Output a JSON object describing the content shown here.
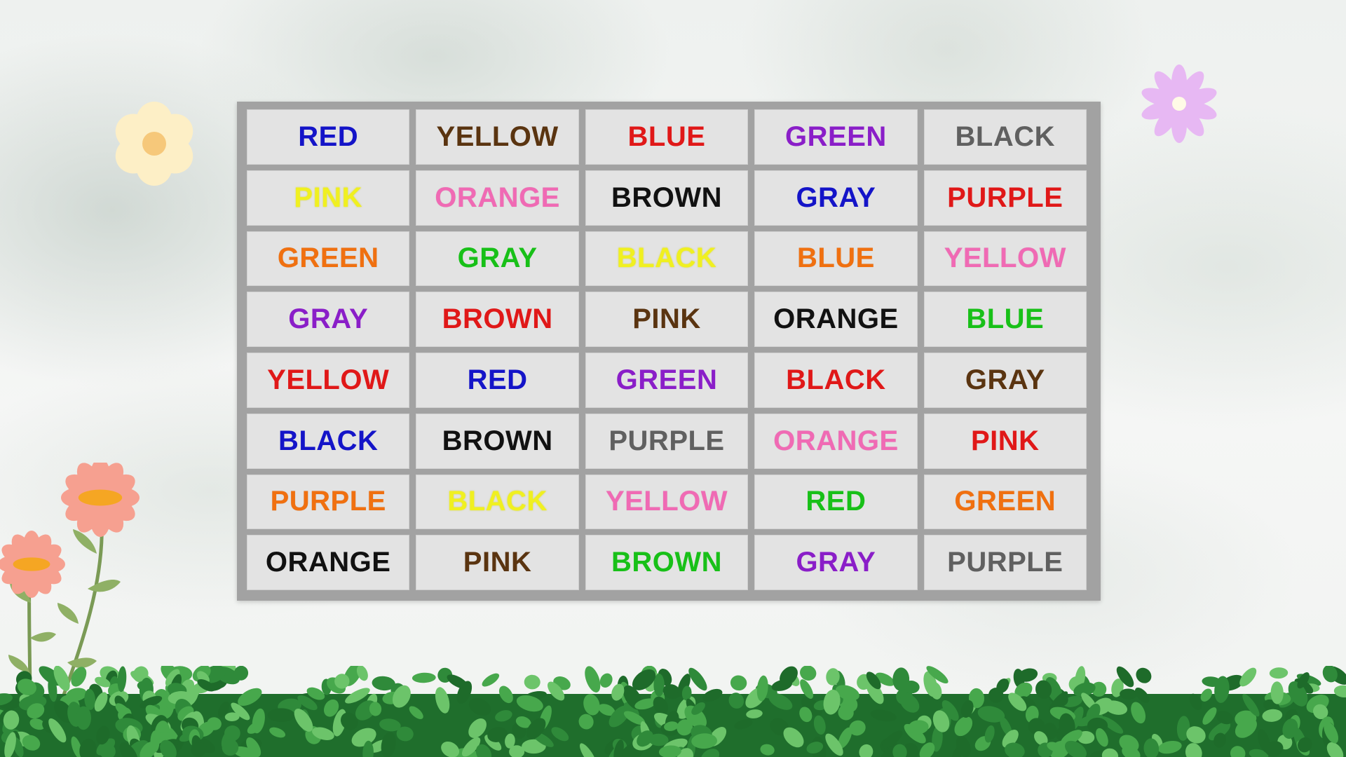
{
  "grid": {
    "rows": [
      [
        {
          "word": "RED",
          "color": "#1414c8"
        },
        {
          "word": "YELLOW",
          "color": "#5a3410"
        },
        {
          "word": "BLUE",
          "color": "#e01818"
        },
        {
          "word": "GREEN",
          "color": "#8a1ec8"
        },
        {
          "word": "BLACK",
          "color": "#606060"
        }
      ],
      [
        {
          "word": "PINK",
          "color": "#f0f020"
        },
        {
          "word": "ORANGE",
          "color": "#f06ab4"
        },
        {
          "word": "BROWN",
          "color": "#111111"
        },
        {
          "word": "GRAY",
          "color": "#1414c8"
        },
        {
          "word": "PURPLE",
          "color": "#e01818"
        }
      ],
      [
        {
          "word": "GREEN",
          "color": "#f07010"
        },
        {
          "word": "GRAY",
          "color": "#18c018"
        },
        {
          "word": "BLACK",
          "color": "#f0f020"
        },
        {
          "word": "BLUE",
          "color": "#f07010"
        },
        {
          "word": "YELLOW",
          "color": "#f06ab4"
        }
      ],
      [
        {
          "word": "GRAY",
          "color": "#8a1ec8"
        },
        {
          "word": "BROWN",
          "color": "#e01818"
        },
        {
          "word": "PINK",
          "color": "#5a3410"
        },
        {
          "word": "ORANGE",
          "color": "#111111"
        },
        {
          "word": "BLUE",
          "color": "#18c018"
        }
      ],
      [
        {
          "word": "YELLOW",
          "color": "#e01818"
        },
        {
          "word": "RED",
          "color": "#1414c8"
        },
        {
          "word": "GREEN",
          "color": "#8a1ec8"
        },
        {
          "word": "BLACK",
          "color": "#e01818"
        },
        {
          "word": "GRAY",
          "color": "#5a3410"
        }
      ],
      [
        {
          "word": "BLACK",
          "color": "#1414c8"
        },
        {
          "word": "BROWN",
          "color": "#111111"
        },
        {
          "word": "PURPLE",
          "color": "#606060"
        },
        {
          "word": "ORANGE",
          "color": "#f06ab4"
        },
        {
          "word": "PINK",
          "color": "#e01818"
        }
      ],
      [
        {
          "word": "PURPLE",
          "color": "#f07010"
        },
        {
          "word": "BLACK",
          "color": "#f0f020"
        },
        {
          "word": "YELLOW",
          "color": "#f06ab4"
        },
        {
          "word": "RED",
          "color": "#18c018"
        },
        {
          "word": "GREEN",
          "color": "#f07010"
        }
      ],
      [
        {
          "word": "ORANGE",
          "color": "#111111"
        },
        {
          "word": "PINK",
          "color": "#5a3410"
        },
        {
          "word": "BROWN",
          "color": "#18c018"
        },
        {
          "word": "GRAY",
          "color": "#8a1ec8"
        },
        {
          "word": "PURPLE",
          "color": "#606060"
        }
      ]
    ]
  },
  "decor": {
    "flower_cream": {
      "icon": "flower-icon",
      "petal_color": "#fdefc6",
      "center_color": "#f6c87a"
    },
    "flower_lilac": {
      "icon": "flower-icon",
      "petal_color": "#e7b8f3",
      "center_color": "#fffbe6"
    },
    "flower_pink": {
      "icon": "flower-icon",
      "petal_color": "#f6a090",
      "center_color": "#f5a623"
    },
    "hedge": {
      "icon": "hedge-icon",
      "leaf_colors": [
        "#1e6b2a",
        "#2f8a3a",
        "#47a84c",
        "#6cc46a"
      ]
    }
  }
}
